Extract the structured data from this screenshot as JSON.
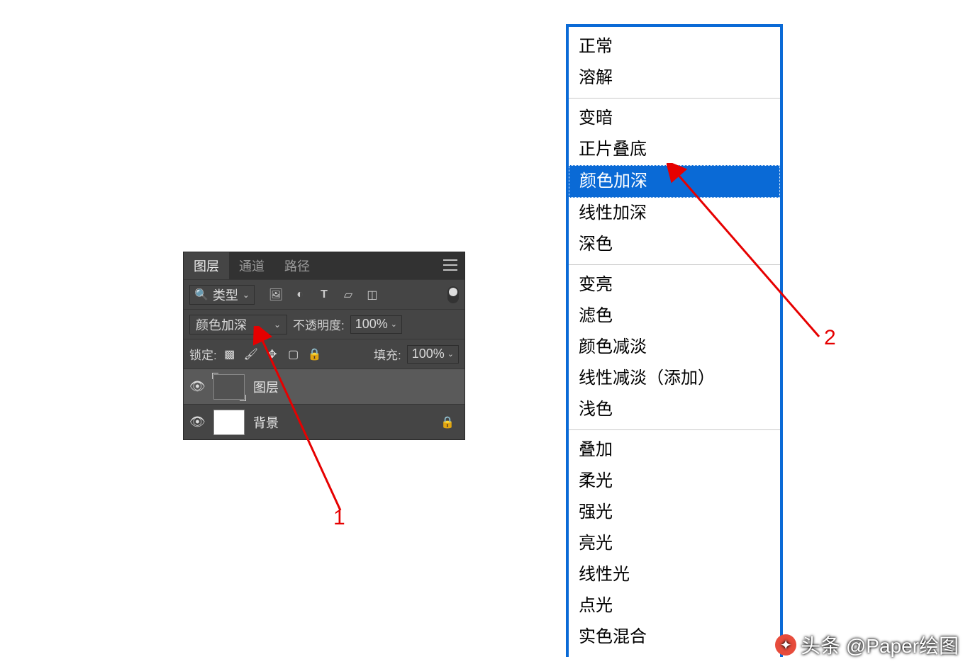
{
  "panel": {
    "tabs": {
      "layers": "图层",
      "channels": "通道",
      "paths": "路径"
    },
    "filter_label": "类型",
    "blend_mode_selected": "颜色加深",
    "opacity_label": "不透明度:",
    "opacity_value": "100%",
    "lock_label": "锁定:",
    "fill_label": "填充:",
    "fill_value": "100%",
    "layer1_name": "图层",
    "layer_bg_name": "背景"
  },
  "blend_menu": {
    "groups": [
      [
        "正常",
        "溶解"
      ],
      [
        "变暗",
        "正片叠底",
        "颜色加深",
        "线性加深",
        "深色"
      ],
      [
        "变亮",
        "滤色",
        "颜色减淡",
        "线性减淡（添加）",
        "浅色"
      ],
      [
        "叠加",
        "柔光",
        "强光",
        "亮光",
        "线性光",
        "点光",
        "实色混合"
      ]
    ],
    "selected": "颜色加深"
  },
  "annotations": {
    "label1": "1",
    "label2": "2"
  },
  "watermark": {
    "text": "头条 @Paper绘图"
  }
}
